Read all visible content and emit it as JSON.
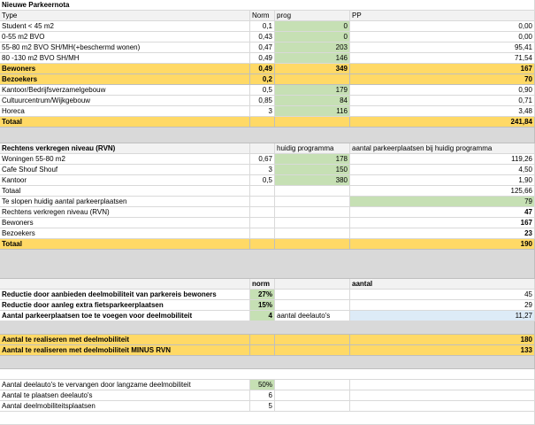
{
  "s1": {
    "title": "Nieuwe Parkeernota",
    "h_type": "Type",
    "h_norm": "Norm",
    "h_prog": "prog",
    "h_pp": "PP",
    "rows": [
      {
        "type": "Student < 45 m2",
        "norm": "0,1",
        "prog": "0",
        "pp": "0,00"
      },
      {
        "type": "0-55 m2 BVO",
        "norm": "0,43",
        "prog": "0",
        "pp": "0,00"
      },
      {
        "type": "55-80 m2 BVO  SH/MH(+beschermd wonen)",
        "norm": "0,47",
        "prog": "203",
        "pp": "95,41"
      },
      {
        "type": "80 -130 m2 BVO SH/MH",
        "norm": "0,49",
        "prog": "146",
        "pp": "71,54"
      }
    ],
    "bewoners": {
      "label": "Bewoners",
      "norm": "0,49",
      "prog": "349",
      "pp": "167"
    },
    "bezoekers": {
      "label": "Bezoekers",
      "norm": "0,2",
      "pp": "70"
    },
    "rows2": [
      {
        "type": "Kantoor/Bedrijfsverzamelgebouw",
        "norm": "0,5",
        "prog": "179",
        "pp": "0,90"
      },
      {
        "type": "Cultuurcentrum/Wijkgebouw",
        "norm": "0,85",
        "prog": "84",
        "pp": "0,71"
      },
      {
        "type": "Horeca",
        "norm": "3",
        "prog": "116",
        "pp": "3,48"
      }
    ],
    "totaal": {
      "label": "Totaal",
      "pp": "241,84"
    }
  },
  "s2": {
    "title": "Rechtens verkregen niveau (RVN)",
    "h_prog": "huidig programma",
    "h_pp": "aantal parkeerplaatsen bij huidig programma",
    "rows": [
      {
        "type": "Woningen 55-80 m2",
        "norm": "0,67",
        "prog": "178",
        "pp": "119,26"
      },
      {
        "type": "Cafe Shouf Shouf",
        "norm": "3",
        "prog": "150",
        "pp": "4,50"
      },
      {
        "type": "Kantoor",
        "norm": "0,5",
        "prog": "380",
        "pp": "1,90"
      }
    ],
    "totaal": {
      "label": "Totaal",
      "pp": "125,66"
    },
    "slopen": {
      "label": "Te slopen huidig aantal parkeerplaatsen",
      "pp": "79"
    },
    "rvn": {
      "label": "Rechtens verkregen niveau (RVN)",
      "pp": "47"
    },
    "bewoners": {
      "label": "Bewoners",
      "pp": "167"
    },
    "bezoekers": {
      "label": "Bezoekers",
      "pp": "23"
    },
    "totaal2": {
      "label": "Totaal",
      "pp": "190"
    }
  },
  "s3": {
    "h_norm": "norm",
    "h_aantal": "aantal",
    "rows": [
      {
        "label": "Reductie door aanbieden deelmobiliteit van parkereis bewoners",
        "norm": "27%",
        "pp": "45"
      },
      {
        "label": "Reductie door aanleg extra fietsparkeerplaatsen",
        "norm": "15%",
        "pp": "29"
      },
      {
        "label": "Aantal parkeerplaatsen toe te voegen voor deelmobiliteit",
        "norm": "4",
        "sub": "aantal deelauto's",
        "pp": "11,27"
      }
    ]
  },
  "s4": {
    "r1": {
      "label": "Aantal te realiseren met  deelmobiliteit",
      "pp": "180"
    },
    "r2": {
      "label": "Aantal te realiseren met  deelmobiliteit MINUS RVN",
      "pp": "133"
    }
  },
  "s5": {
    "rows": [
      {
        "label": "Aantal deelauto's te vervangen door langzame deelmobiliteit",
        "norm": "50%"
      },
      {
        "label": "Aantal te plaatsen deelauto's",
        "norm": "6"
      },
      {
        "label": "Aantal deelmobiliteitsplaatsen",
        "norm": "5"
      }
    ]
  }
}
